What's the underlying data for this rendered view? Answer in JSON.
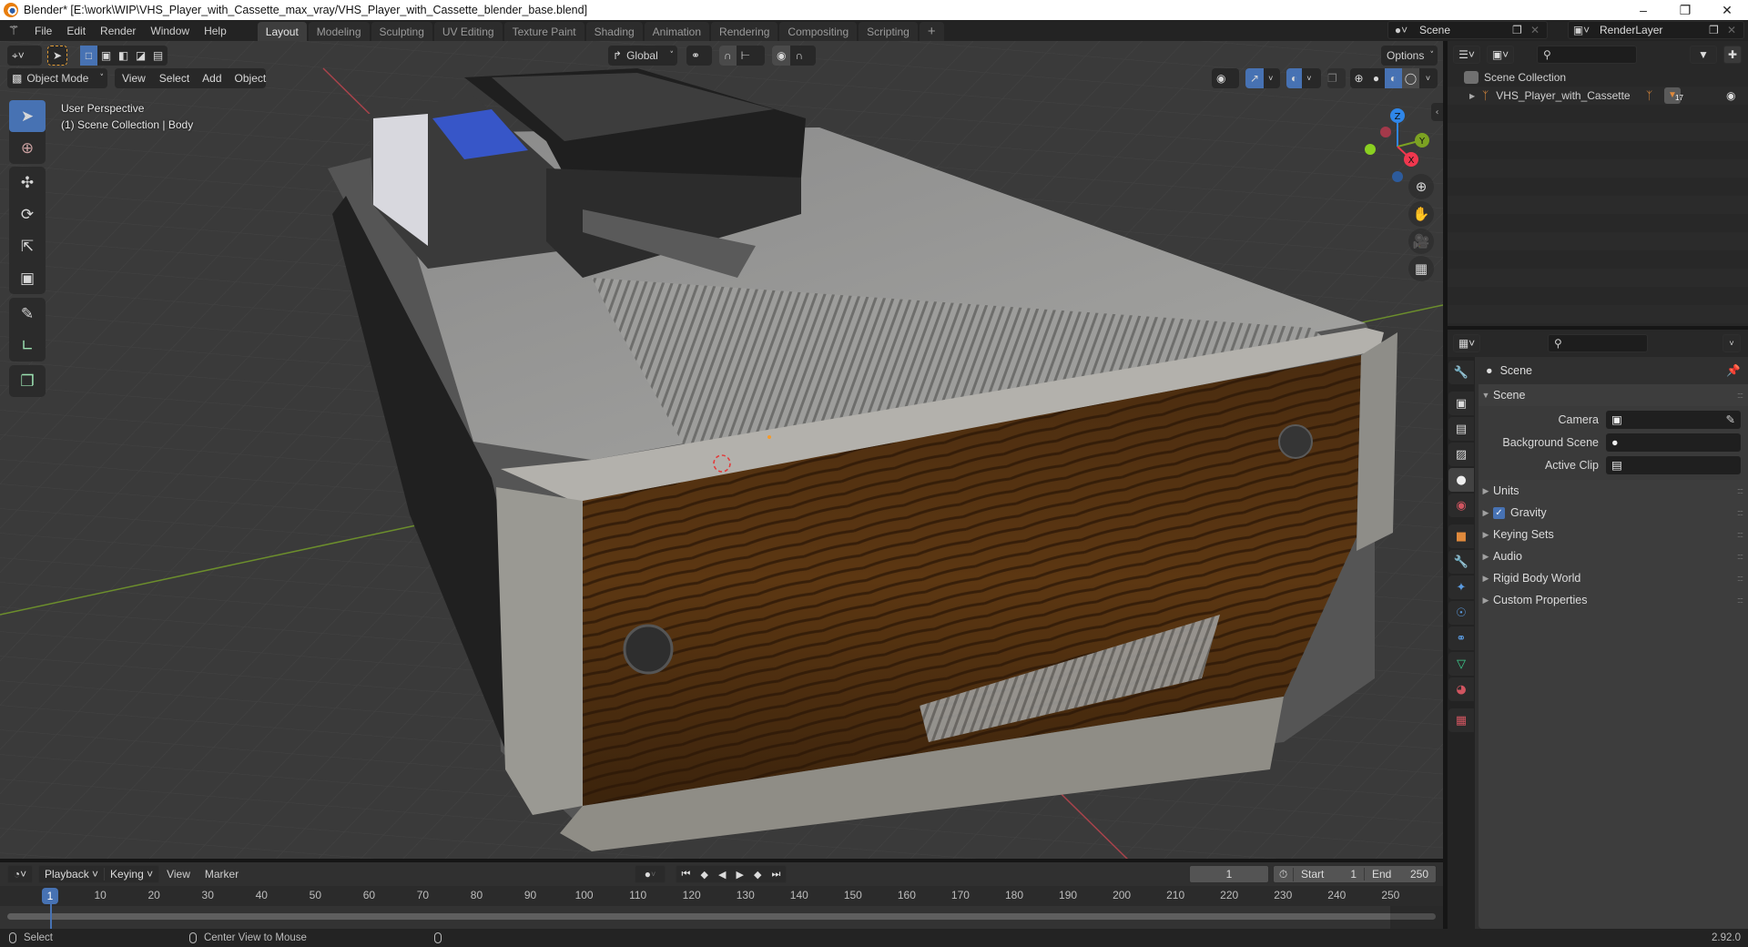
{
  "window": {
    "title": "Blender* [E:\\work\\WIP\\VHS_Player_with_Cassette_max_vray/VHS_Player_with_Cassette_blender_base.blend]",
    "controls": [
      "minimize",
      "restore",
      "close"
    ]
  },
  "menubar": {
    "items": [
      "File",
      "Edit",
      "Render",
      "Window",
      "Help"
    ],
    "workspaces": [
      "Layout",
      "Modeling",
      "Sculpting",
      "UV Editing",
      "Texture Paint",
      "Shading",
      "Animation",
      "Rendering",
      "Compositing",
      "Scripting"
    ],
    "active_workspace": "Layout",
    "add_workspace": "+",
    "scene": "Scene",
    "view_layer": "RenderLayer"
  },
  "viewport": {
    "mode": "Object Mode",
    "menus": [
      "View",
      "Select",
      "Add",
      "Object"
    ],
    "transform_orientation": "Global",
    "options_label": "Options",
    "overlay_text": {
      "line1": "User Perspective",
      "line2": "(1) Scene Collection | Body"
    },
    "gizmo_axes": {
      "x": "X",
      "y": "Y",
      "z": "Z"
    },
    "colors": {
      "x": "#f0374e",
      "y": "#7ca222",
      "z": "#2f86e8",
      "grid_x": "#a8434b",
      "grid_y": "#6c8e2c",
      "active": "#4772b3"
    },
    "tools": [
      "select-box",
      "cursor",
      "move",
      "rotate",
      "scale",
      "transform",
      "annotate",
      "measure",
      "add-cube"
    ],
    "nav": [
      "zoom",
      "pan",
      "camera-view",
      "perspective-toggle"
    ]
  },
  "outliner": {
    "search_placeholder": "",
    "root": "Scene Collection",
    "items": [
      {
        "name": "VHS_Player_with_Cassette",
        "children_count": "17",
        "visible": true
      }
    ]
  },
  "properties": {
    "search_placeholder": "",
    "context": "Scene",
    "panel_title": "Scene",
    "fields": [
      {
        "label": "Camera",
        "value": ""
      },
      {
        "label": "Background Scene",
        "value": ""
      },
      {
        "label": "Active Clip",
        "value": ""
      }
    ],
    "collapsed_panels": [
      {
        "label": "Units",
        "checkbox": false
      },
      {
        "label": "Gravity",
        "checkbox": true,
        "checked": true
      },
      {
        "label": "Keying Sets",
        "checkbox": false
      },
      {
        "label": "Audio",
        "checkbox": false
      },
      {
        "label": "Rigid Body World",
        "checkbox": false
      },
      {
        "label": "Custom Properties",
        "checkbox": false
      }
    ],
    "tabs": [
      "tool",
      "render",
      "output",
      "view-layer",
      "scene",
      "world",
      "object",
      "modifiers",
      "particles",
      "physics",
      "constraints",
      "data",
      "material",
      "texture"
    ],
    "active_tab": "scene"
  },
  "timeline": {
    "menus": [
      "Playback",
      "Keying",
      "View",
      "Marker"
    ],
    "current_frame": "1",
    "start_label": "Start",
    "start": "1",
    "end_label": "End",
    "end": "250",
    "ticks": [
      "10",
      "20",
      "30",
      "40",
      "50",
      "60",
      "70",
      "80",
      "90",
      "100",
      "110",
      "120",
      "130",
      "140",
      "150",
      "160",
      "170",
      "180",
      "190",
      "200",
      "210",
      "220",
      "230",
      "240",
      "250"
    ],
    "playhead": "1"
  },
  "statusbar": {
    "left": "Select",
    "middle": "Center View to Mouse",
    "version": "2.92.0"
  }
}
